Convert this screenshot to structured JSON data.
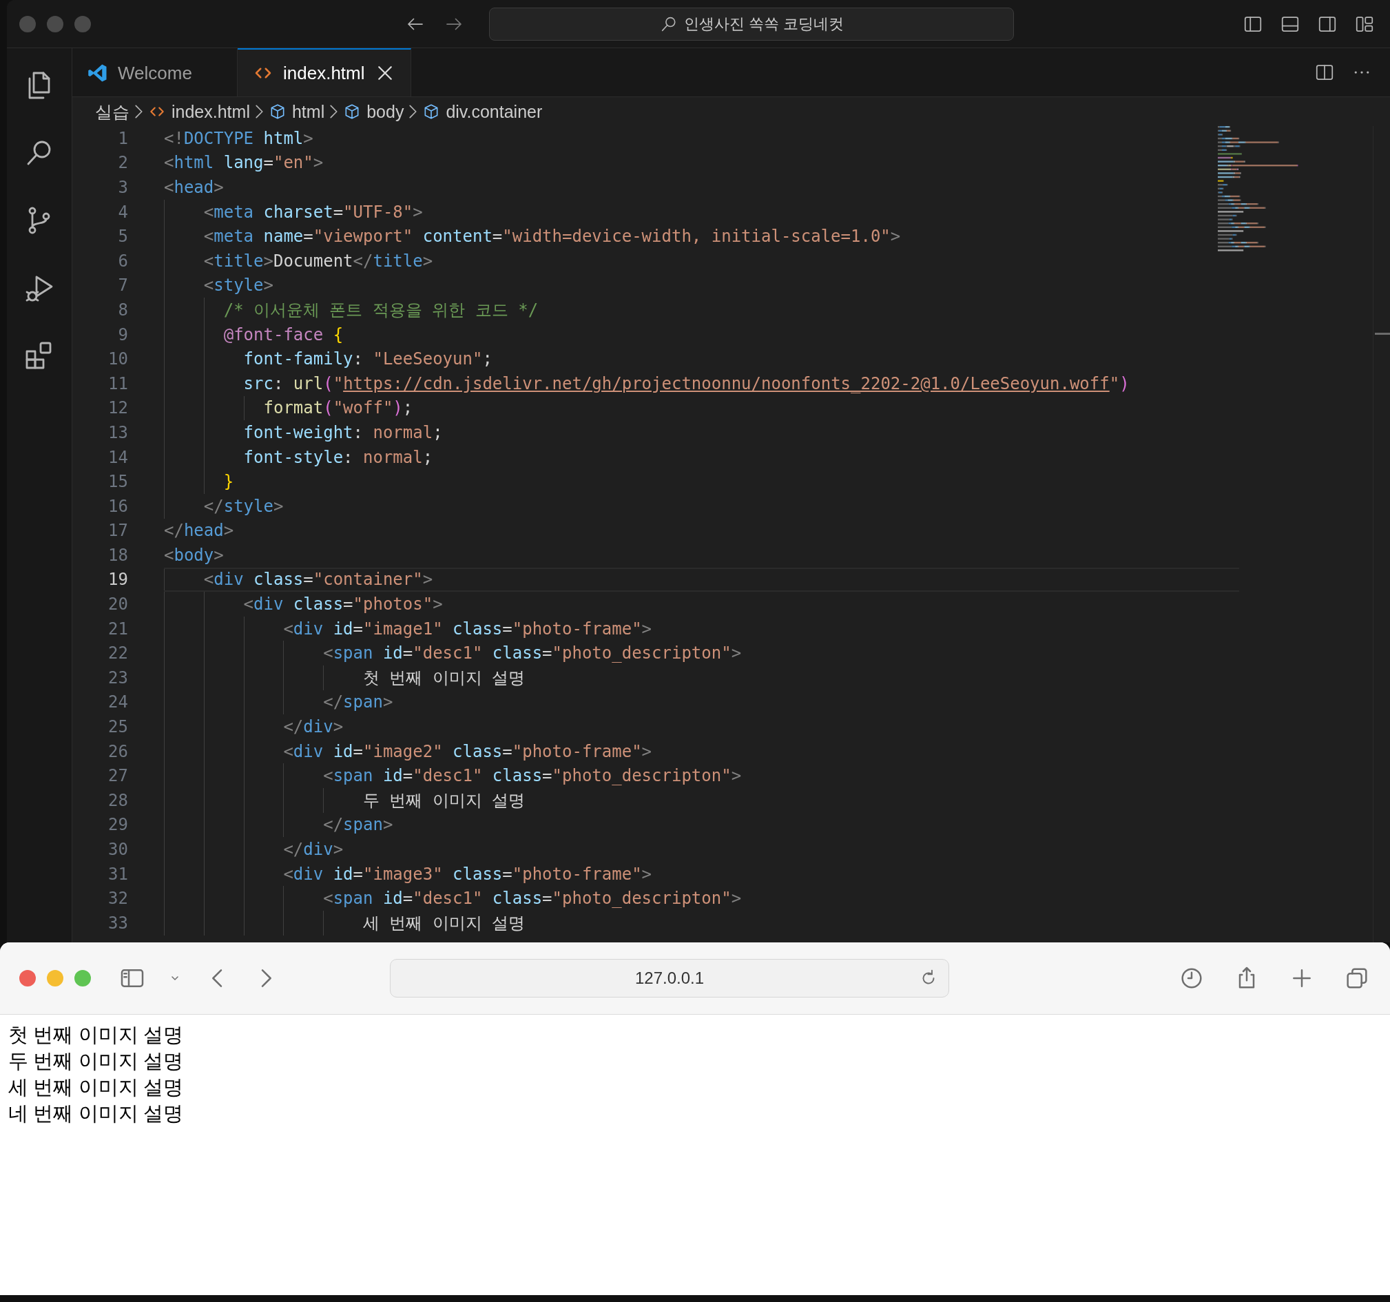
{
  "vscode": {
    "command_center": {
      "value": "인생사진 쏙쏙 코딩네컷"
    },
    "tabs": [
      {
        "label": "Welcome",
        "kind": "welcome",
        "selected": false
      },
      {
        "label": "index.html",
        "kind": "html",
        "selected": true
      }
    ],
    "breadcrumb": [
      {
        "label": "실습",
        "kind": "folder"
      },
      {
        "label": "index.html",
        "kind": "html"
      },
      {
        "label": "html",
        "kind": "element"
      },
      {
        "label": "body",
        "kind": "element"
      },
      {
        "label": "div.container",
        "kind": "element"
      }
    ],
    "editor": {
      "lines": [
        {
          "number": "1",
          "current": false,
          "tokens": [
            {
              "kind": "punct",
              "text": "<!"
            },
            {
              "kind": "tag",
              "text": "DOCTYPE"
            },
            {
              "kind": "attr",
              "text": " html"
            },
            {
              "kind": "punct",
              "text": ">"
            }
          ]
        },
        {
          "number": "2",
          "current": false,
          "tokens": [
            {
              "kind": "punct",
              "text": "<"
            },
            {
              "kind": "tag",
              "text": "html"
            },
            {
              "kind": "attr",
              "text": " lang"
            },
            {
              "kind": "plain",
              "text": "="
            },
            {
              "kind": "string",
              "text": "\"en\""
            },
            {
              "kind": "punct",
              "text": ">"
            }
          ]
        },
        {
          "number": "3",
          "current": false,
          "tokens": [
            {
              "kind": "punct",
              "text": "<"
            },
            {
              "kind": "tag",
              "text": "head"
            },
            {
              "kind": "punct",
              "text": ">"
            }
          ]
        },
        {
          "number": "4",
          "current": false,
          "tokens": [
            {
              "kind": "punct",
              "text": "    <"
            },
            {
              "kind": "tag",
              "text": "meta"
            },
            {
              "kind": "attr",
              "text": " charset"
            },
            {
              "kind": "plain",
              "text": "="
            },
            {
              "kind": "string",
              "text": "\"UTF-8\""
            },
            {
              "kind": "punct",
              "text": ">"
            }
          ]
        },
        {
          "number": "5",
          "current": false,
          "tokens": [
            {
              "kind": "punct",
              "text": "    <"
            },
            {
              "kind": "tag",
              "text": "meta"
            },
            {
              "kind": "attr",
              "text": " name"
            },
            {
              "kind": "plain",
              "text": "="
            },
            {
              "kind": "string",
              "text": "\"viewport\""
            },
            {
              "kind": "attr",
              "text": " content"
            },
            {
              "kind": "plain",
              "text": "="
            },
            {
              "kind": "string",
              "text": "\"width=device-width, initial-scale=1.0\""
            },
            {
              "kind": "punct",
              "text": ">"
            }
          ]
        },
        {
          "number": "6",
          "current": false,
          "tokens": [
            {
              "kind": "punct",
              "text": "    <"
            },
            {
              "kind": "tag",
              "text": "title"
            },
            {
              "kind": "punct",
              "text": ">"
            },
            {
              "kind": "plain",
              "text": "Document"
            },
            {
              "kind": "punct",
              "text": "</"
            },
            {
              "kind": "tag",
              "text": "title"
            },
            {
              "kind": "punct",
              "text": ">"
            }
          ]
        },
        {
          "number": "7",
          "current": false,
          "tokens": [
            {
              "kind": "punct",
              "text": "    <"
            },
            {
              "kind": "tag",
              "text": "style"
            },
            {
              "kind": "punct",
              "text": ">"
            }
          ]
        },
        {
          "number": "8",
          "current": false,
          "tokens": [
            {
              "kind": "comment",
              "text": "      /* 이서윤체 폰트 적용을 위한 코드 */"
            }
          ]
        },
        {
          "number": "9",
          "current": false,
          "tokens": [
            {
              "kind": "atrule",
              "text": "      @font-face"
            },
            {
              "kind": "brace",
              "text": " {"
            }
          ]
        },
        {
          "number": "10",
          "current": false,
          "tokens": [
            {
              "kind": "prop",
              "text": "        font-family"
            },
            {
              "kind": "plain",
              "text": ": "
            },
            {
              "kind": "string",
              "text": "\"LeeSeoyun\""
            },
            {
              "kind": "plain",
              "text": ";"
            }
          ]
        },
        {
          "number": "11",
          "current": false,
          "tokens": [
            {
              "kind": "prop",
              "text": "        src"
            },
            {
              "kind": "plain",
              "text": ": "
            },
            {
              "kind": "func",
              "text": "url"
            },
            {
              "kind": "paren",
              "text": "("
            },
            {
              "kind": "string",
              "text": "\""
            },
            {
              "kind": "url",
              "text": "https://cdn.jsdelivr.net/gh/projectnoonnu/noonfonts_2202-2@1.0/LeeSeoyun.woff"
            },
            {
              "kind": "string",
              "text": "\""
            },
            {
              "kind": "paren",
              "text": ")"
            }
          ]
        },
        {
          "number": "12",
          "current": false,
          "tokens": [
            {
              "kind": "func",
              "text": "          format"
            },
            {
              "kind": "paren",
              "text": "("
            },
            {
              "kind": "string",
              "text": "\"woff\""
            },
            {
              "kind": "paren",
              "text": ")"
            },
            {
              "kind": "plain",
              "text": ";"
            }
          ]
        },
        {
          "number": "13",
          "current": false,
          "tokens": [
            {
              "kind": "prop",
              "text": "        font-weight"
            },
            {
              "kind": "plain",
              "text": ": "
            },
            {
              "kind": "string",
              "text": "normal"
            },
            {
              "kind": "plain",
              "text": ";"
            }
          ]
        },
        {
          "number": "14",
          "current": false,
          "tokens": [
            {
              "kind": "prop",
              "text": "        font-style"
            },
            {
              "kind": "plain",
              "text": ": "
            },
            {
              "kind": "string",
              "text": "normal"
            },
            {
              "kind": "plain",
              "text": ";"
            }
          ]
        },
        {
          "number": "15",
          "current": false,
          "tokens": [
            {
              "kind": "brace",
              "text": "      }"
            }
          ]
        },
        {
          "number": "16",
          "current": false,
          "tokens": [
            {
              "kind": "punct",
              "text": "    </"
            },
            {
              "kind": "tag",
              "text": "style"
            },
            {
              "kind": "punct",
              "text": ">"
            }
          ]
        },
        {
          "number": "17",
          "current": false,
          "tokens": [
            {
              "kind": "punct",
              "text": "</"
            },
            {
              "kind": "tag",
              "text": "head"
            },
            {
              "kind": "punct",
              "text": ">"
            }
          ]
        },
        {
          "number": "18",
          "current": false,
          "tokens": [
            {
              "kind": "punct",
              "text": "<"
            },
            {
              "kind": "tag",
              "text": "body"
            },
            {
              "kind": "punct",
              "text": ">"
            }
          ]
        },
        {
          "number": "19",
          "current": true,
          "tokens": [
            {
              "kind": "punct",
              "text": "    <"
            },
            {
              "kind": "tag",
              "text": "div"
            },
            {
              "kind": "attr",
              "text": " class"
            },
            {
              "kind": "plain",
              "text": "="
            },
            {
              "kind": "string",
              "text": "\"container\""
            },
            {
              "kind": "punct",
              "text": ">"
            }
          ]
        },
        {
          "number": "20",
          "current": false,
          "tokens": [
            {
              "kind": "punct",
              "text": "        <"
            },
            {
              "kind": "tag",
              "text": "div"
            },
            {
              "kind": "attr",
              "text": " class"
            },
            {
              "kind": "plain",
              "text": "="
            },
            {
              "kind": "string",
              "text": "\"photos\""
            },
            {
              "kind": "punct",
              "text": ">"
            }
          ]
        },
        {
          "number": "21",
          "current": false,
          "tokens": [
            {
              "kind": "punct",
              "text": "            <"
            },
            {
              "kind": "tag",
              "text": "div"
            },
            {
              "kind": "attr",
              "text": " id"
            },
            {
              "kind": "plain",
              "text": "="
            },
            {
              "kind": "string",
              "text": "\"image1\""
            },
            {
              "kind": "attr",
              "text": " class"
            },
            {
              "kind": "plain",
              "text": "="
            },
            {
              "kind": "string",
              "text": "\"photo-frame\""
            },
            {
              "kind": "punct",
              "text": ">"
            }
          ]
        },
        {
          "number": "22",
          "current": false,
          "tokens": [
            {
              "kind": "punct",
              "text": "                <"
            },
            {
              "kind": "tag",
              "text": "span"
            },
            {
              "kind": "attr",
              "text": " id"
            },
            {
              "kind": "plain",
              "text": "="
            },
            {
              "kind": "string",
              "text": "\"desc1\""
            },
            {
              "kind": "attr",
              "text": " class"
            },
            {
              "kind": "plain",
              "text": "="
            },
            {
              "kind": "string",
              "text": "\"photo_descripton\""
            },
            {
              "kind": "punct",
              "text": ">"
            }
          ]
        },
        {
          "number": "23",
          "current": false,
          "tokens": [
            {
              "kind": "plain",
              "text": "                    첫 번째 이미지 설명"
            }
          ]
        },
        {
          "number": "24",
          "current": false,
          "tokens": [
            {
              "kind": "punct",
              "text": "                </"
            },
            {
              "kind": "tag",
              "text": "span"
            },
            {
              "kind": "punct",
              "text": ">"
            }
          ]
        },
        {
          "number": "25",
          "current": false,
          "tokens": [
            {
              "kind": "punct",
              "text": "            </"
            },
            {
              "kind": "tag",
              "text": "div"
            },
            {
              "kind": "punct",
              "text": ">"
            }
          ]
        },
        {
          "number": "26",
          "current": false,
          "tokens": [
            {
              "kind": "punct",
              "text": "            <"
            },
            {
              "kind": "tag",
              "text": "div"
            },
            {
              "kind": "attr",
              "text": " id"
            },
            {
              "kind": "plain",
              "text": "="
            },
            {
              "kind": "string",
              "text": "\"image2\""
            },
            {
              "kind": "attr",
              "text": " class"
            },
            {
              "kind": "plain",
              "text": "="
            },
            {
              "kind": "string",
              "text": "\"photo-frame\""
            },
            {
              "kind": "punct",
              "text": ">"
            }
          ]
        },
        {
          "number": "27",
          "current": false,
          "tokens": [
            {
              "kind": "punct",
              "text": "                <"
            },
            {
              "kind": "tag",
              "text": "span"
            },
            {
              "kind": "attr",
              "text": " id"
            },
            {
              "kind": "plain",
              "text": "="
            },
            {
              "kind": "string",
              "text": "\"desc1\""
            },
            {
              "kind": "attr",
              "text": " class"
            },
            {
              "kind": "plain",
              "text": "="
            },
            {
              "kind": "string",
              "text": "\"photo_descripton\""
            },
            {
              "kind": "punct",
              "text": ">"
            }
          ]
        },
        {
          "number": "28",
          "current": false,
          "tokens": [
            {
              "kind": "plain",
              "text": "                    두 번째 이미지 설명"
            }
          ]
        },
        {
          "number": "29",
          "current": false,
          "tokens": [
            {
              "kind": "punct",
              "text": "                </"
            },
            {
              "kind": "tag",
              "text": "span"
            },
            {
              "kind": "punct",
              "text": ">"
            }
          ]
        },
        {
          "number": "30",
          "current": false,
          "tokens": [
            {
              "kind": "punct",
              "text": "            </"
            },
            {
              "kind": "tag",
              "text": "div"
            },
            {
              "kind": "punct",
              "text": ">"
            }
          ]
        },
        {
          "number": "31",
          "current": false,
          "tokens": [
            {
              "kind": "punct",
              "text": "            <"
            },
            {
              "kind": "tag",
              "text": "div"
            },
            {
              "kind": "attr",
              "text": " id"
            },
            {
              "kind": "plain",
              "text": "="
            },
            {
              "kind": "string",
              "text": "\"image3\""
            },
            {
              "kind": "attr",
              "text": " class"
            },
            {
              "kind": "plain",
              "text": "="
            },
            {
              "kind": "string",
              "text": "\"photo-frame\""
            },
            {
              "kind": "punct",
              "text": ">"
            }
          ]
        },
        {
          "number": "32",
          "current": false,
          "tokens": [
            {
              "kind": "punct",
              "text": "                <"
            },
            {
              "kind": "tag",
              "text": "span"
            },
            {
              "kind": "attr",
              "text": " id"
            },
            {
              "kind": "plain",
              "text": "="
            },
            {
              "kind": "string",
              "text": "\"desc1\""
            },
            {
              "kind": "attr",
              "text": " class"
            },
            {
              "kind": "plain",
              "text": "="
            },
            {
              "kind": "string",
              "text": "\"photo_descripton\""
            },
            {
              "kind": "punct",
              "text": ">"
            }
          ]
        },
        {
          "number": "33",
          "current": false,
          "tokens": [
            {
              "kind": "plain",
              "text": "                    세 번째 이미지 설명"
            }
          ]
        }
      ]
    }
  },
  "browser": {
    "address": {
      "value": "127.0.0.1"
    },
    "page_lines": [
      "첫 번째 이미지 설명",
      "두 번째 이미지 설명",
      "세 번째 이미지 설명",
      "네 번째 이미지 설명"
    ]
  }
}
